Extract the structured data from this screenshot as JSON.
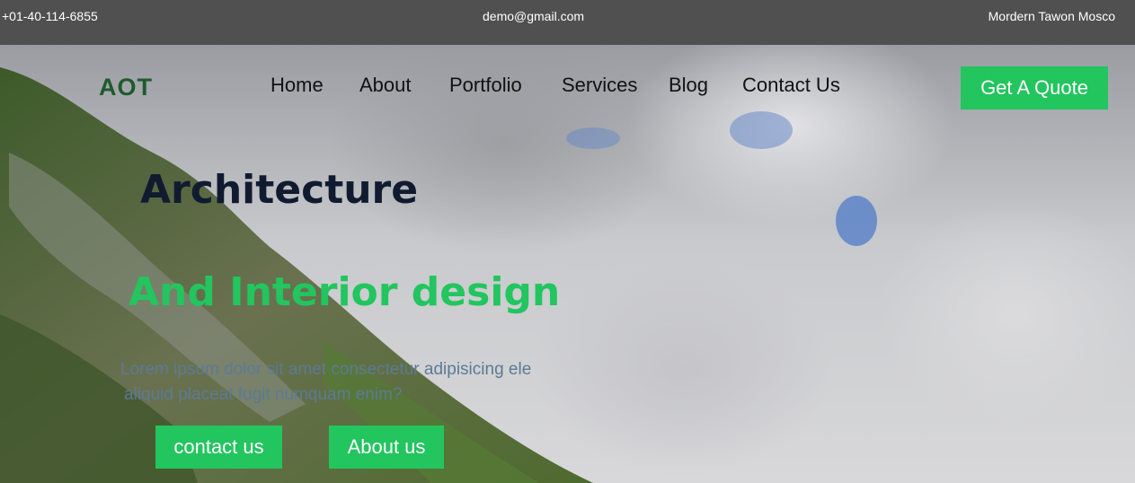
{
  "topbar": {
    "phone": "+01-40-114-6855",
    "email": "demo@gmail.com",
    "address": "Mordern Tawon Mosco"
  },
  "header": {
    "logo": "AOT",
    "nav": [
      {
        "label": "Home"
      },
      {
        "label": "About"
      },
      {
        "label": "Portfolio"
      },
      {
        "label": "Services"
      },
      {
        "label": "Blog"
      },
      {
        "label": "Contact Us"
      }
    ],
    "quote_button": "Get A Quote"
  },
  "hero": {
    "title_line1": "Architecture",
    "title_line2": "And Interior design",
    "description_line1": "Lorem ipsum dolor sit amet consectetur adipisicing ele",
    "description_line2": "aliquid placeat fugit numquam enim?",
    "contact_button": "contact us",
    "about_button": "About us"
  },
  "colors": {
    "accent": "#22c55e",
    "logo": "#1f5a2c",
    "title": "#111b30",
    "topbar": "#505050"
  }
}
